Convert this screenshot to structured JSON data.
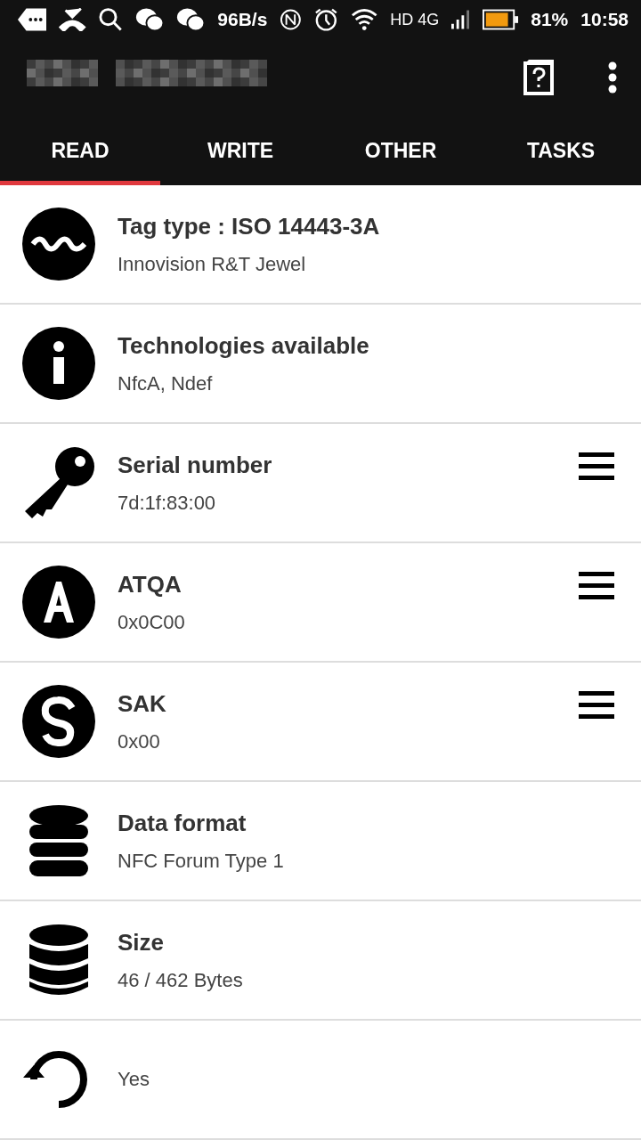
{
  "status_bar": {
    "speed": "96B/s",
    "network": "HD 4G",
    "battery": "81%",
    "time": "10:58"
  },
  "tabs": [
    {
      "label": "READ",
      "selected": true
    },
    {
      "label": "WRITE",
      "selected": false
    },
    {
      "label": "OTHER",
      "selected": false
    },
    {
      "label": "TASKS",
      "selected": false
    }
  ],
  "rows": [
    {
      "title": "Tag type : ISO 14443-3A",
      "value": "Innovision R&T Jewel",
      "menu": false
    },
    {
      "title": "Technologies available",
      "value": "NfcA, Ndef",
      "menu": false
    },
    {
      "title": "Serial number",
      "value": "7d:1f:83:00",
      "menu": true
    },
    {
      "title": "ATQA",
      "value": "0x0C00",
      "menu": true
    },
    {
      "title": "SAK",
      "value": "0x00",
      "menu": true
    },
    {
      "title": "Data format",
      "value": "NFC Forum Type 1",
      "menu": false
    },
    {
      "title": "Size",
      "value": "46 / 462 Bytes",
      "menu": false
    },
    {
      "value": "Yes",
      "menu": false
    }
  ]
}
